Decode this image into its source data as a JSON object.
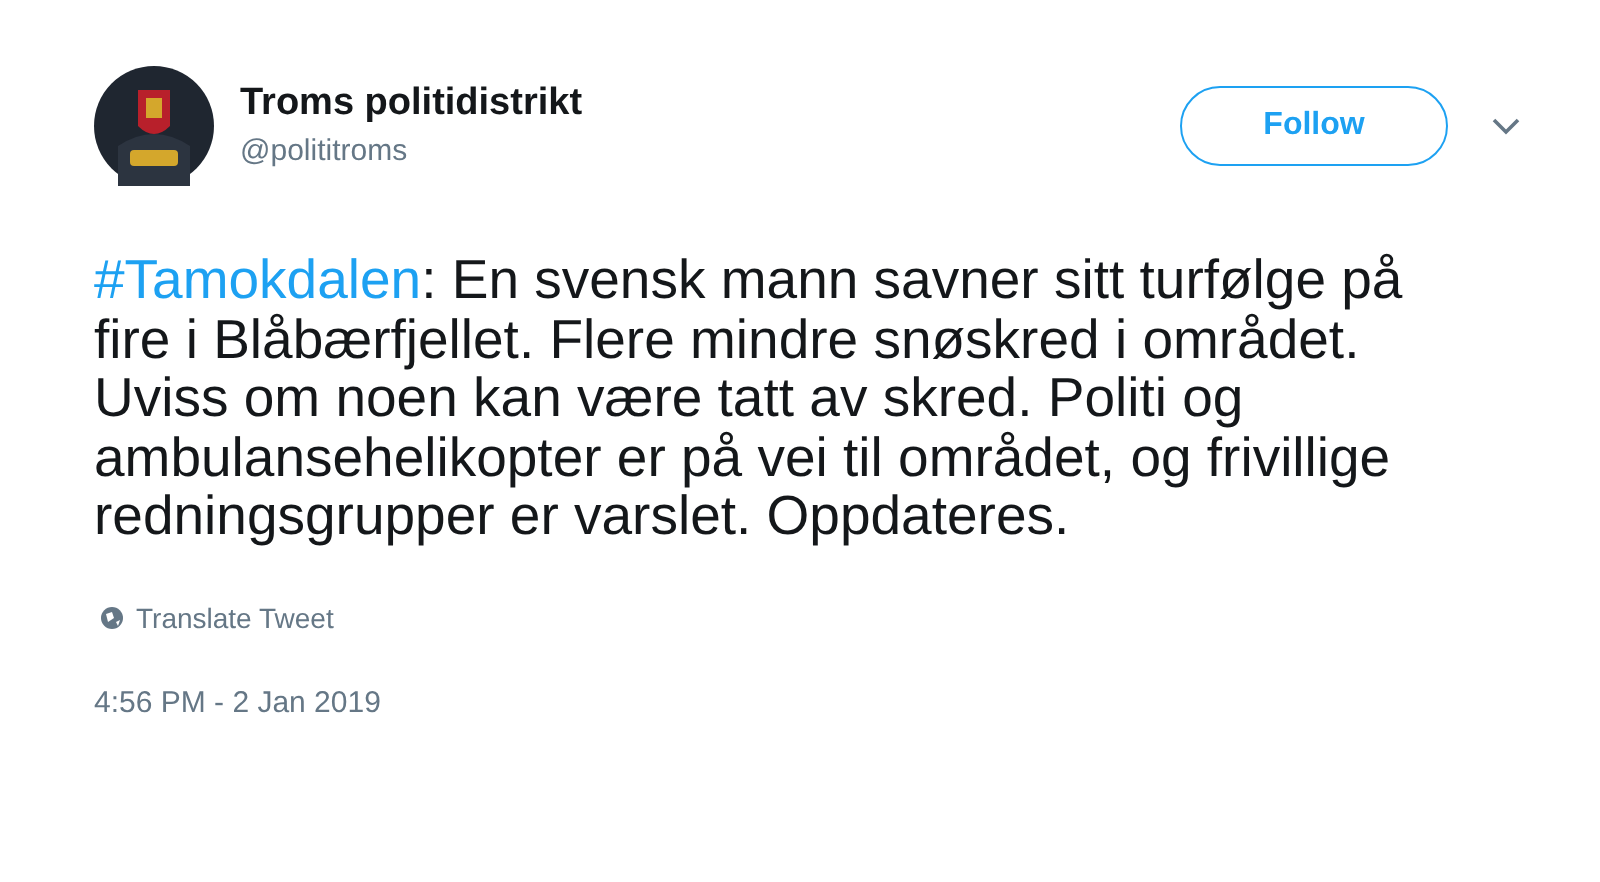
{
  "author": {
    "name": "Troms politidistrikt",
    "handle": "@polititroms"
  },
  "follow_button": {
    "label": "Follow"
  },
  "tweet": {
    "hashtag": "#Tamokdalen",
    "text": ": En svensk mann savner sitt turfølge på fire i Blåbærfjellet. Flere mindre snøskred i området. Uviss om noen kan være tatt av skred. Politi og ambulansehelikopter er på vei til området, og frivillige redningsgrupper er varslet. Oppdateres."
  },
  "translate": {
    "label": "Translate Tweet"
  },
  "timestamp": "4:56 PM - 2 Jan 2019"
}
